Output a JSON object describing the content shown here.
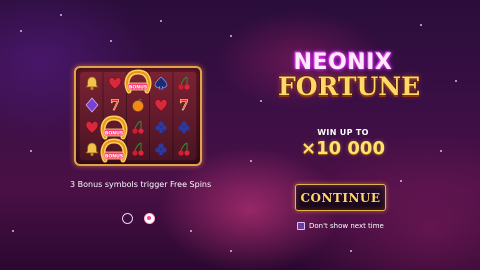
{
  "logo": {
    "line1": "NEONIX",
    "line2": "FORTUNE"
  },
  "win": {
    "label": "WIN UP TO",
    "value": "×10 000"
  },
  "continue_button": {
    "label": "CONTINUE"
  },
  "dont_show": {
    "label": "Don't show next time",
    "checked": false
  },
  "caption": "3 Bonus symbols trigger Free Spins",
  "bonus_symbol": {
    "label": "BONUS"
  },
  "pagination": {
    "total": 2,
    "active": 2
  },
  "reel_symbols": [
    [
      "bell",
      "heart",
      "bonus",
      "spade",
      "cherry"
    ],
    [
      "diamond",
      "seven",
      "orange",
      "heart",
      "seven"
    ],
    [
      "heart",
      "bonus",
      "cherry",
      "club",
      "club"
    ],
    [
      "bell",
      "bonus",
      "cherry",
      "club",
      "cherry"
    ]
  ],
  "colors": {
    "accent_gold": "#ffd66a",
    "neon_pink": "#ff36d0",
    "frame_orange": "#e3a24a"
  }
}
